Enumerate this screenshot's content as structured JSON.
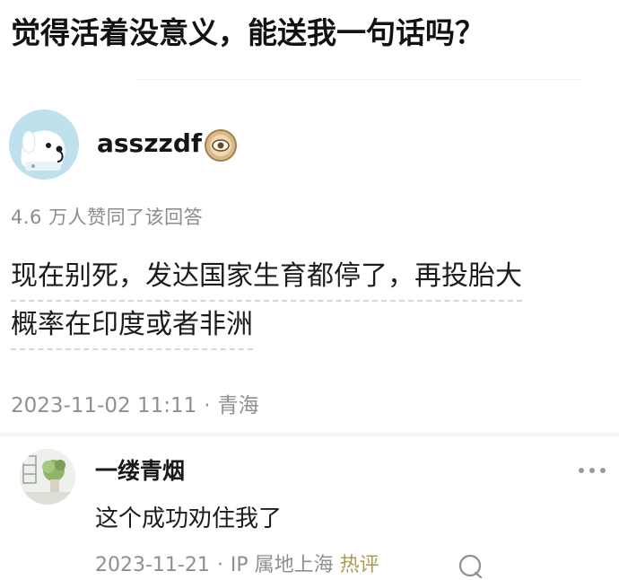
{
  "question": {
    "title": "觉得活着没意义，能送我一句话吗？"
  },
  "answer": {
    "author_name": "asszzdf",
    "author_avatar_icon": "cartoon-dog-avatar-icon",
    "author_badge_icon": "eye-badge-icon",
    "upvote_text": "4.6 万人赞同了该回答",
    "body_lines": [
      "现在别死，发达国家生育都停了，再投胎大",
      "概率在印度或者非洲"
    ],
    "date": "2023-11-02 11:11",
    "location": "青海"
  },
  "comment": {
    "author_name": "一缕青烟",
    "avatar_icon": "plant-photo-avatar-icon",
    "more_icon": "more-dots-icon",
    "text": "这个成功劝住我了",
    "date": "2023-11-21",
    "location": "IP 属地上海",
    "hot_label": "热评",
    "reply_icon": "reply-bubble-icon"
  },
  "colors": {
    "meta_gray": "#8f8f8f",
    "hot_tag": "#b09a52",
    "avatar_blue": "#bfe1ee",
    "badge_tan": "#c9a26b"
  }
}
